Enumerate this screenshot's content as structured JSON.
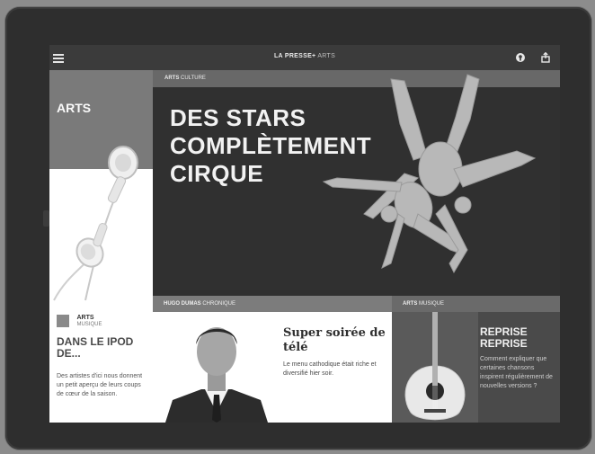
{
  "topbar": {
    "brand_bold": "LA PRESSE+",
    "brand_section": "ARTS",
    "menu_icon": "hamburger-icon",
    "icons": [
      "settings-icon",
      "share-icon"
    ]
  },
  "left": {
    "section": "ARTS",
    "tag_section": "ARTS",
    "tag_sub": "MUSIQUE",
    "title": "DANS LE IPOD DE...",
    "desc": "Des artistes d'ici nous donnent un petit aperçu de leurs coups de cœur de la saison."
  },
  "hero": {
    "tag_section": "ARTS",
    "tag_sub": "CULTURE",
    "title": "DES STARS COMPLÈTEMENT CIRQUE"
  },
  "card_mid": {
    "tag_author": "HUGO DUMAS",
    "tag_sub": "CHRONIQUE",
    "title": "Super soirée de télé",
    "desc": "Le menu cathodique était riche et diversifié hier soir."
  },
  "card_right": {
    "tag_section": "ARTS",
    "tag_sub": "MUSIQUE",
    "title": "REPRISE REPRISE",
    "desc": "Comment expliquer que certaines chansons inspirent régulièrement de nouvelles versions ?"
  }
}
